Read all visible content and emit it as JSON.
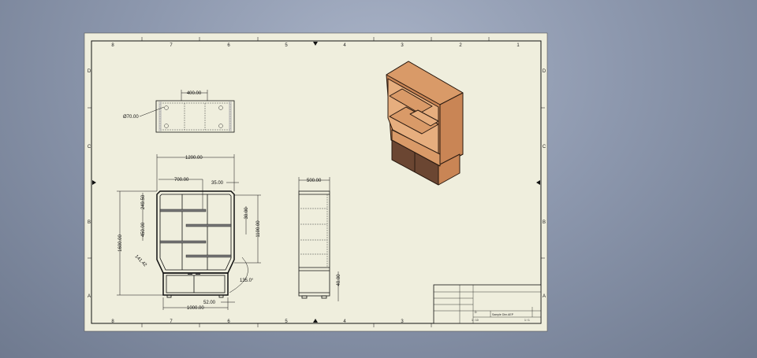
{
  "sheet": {
    "zones_columns": [
      "8",
      "7",
      "6",
      "5",
      "4",
      "3",
      "2",
      "1"
    ],
    "zones_rows": [
      "D",
      "C",
      "B",
      "A"
    ]
  },
  "top_view": {
    "width_dim": "400.00",
    "hole_dim": "Ø70.00"
  },
  "front_view": {
    "overall_width": "1200.00",
    "shelf_width": "700.00",
    "offset": "35.00",
    "top_gap": "249.50",
    "shelf_spacing": "450.00",
    "overall_height": "1600.00",
    "upper_height": "1100.00",
    "shelf_thickness": "30.00",
    "chamfer": "141.42",
    "angle": "135.0°",
    "base_offset": "52.00",
    "base_width": "1000.00"
  },
  "side_view": {
    "depth": "500.00",
    "foot_height": "40.00"
  },
  "title_block": {
    "file_name": "Sample Dim.AEP",
    "scale": "1 : 10",
    "sheet": "1 / 1",
    "size": "D"
  },
  "colors": {
    "paper": "#efeedd",
    "wood": "#d99a68",
    "wood_side": "#c98555",
    "drawer": "#6b4632"
  }
}
